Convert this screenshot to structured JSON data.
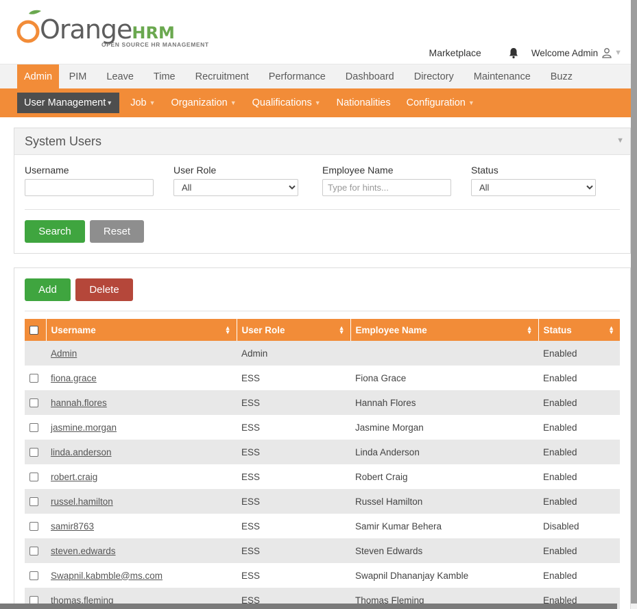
{
  "brand": {
    "logo_primary": "Orange",
    "logo_secondary": "HRM",
    "tagline": "OPEN SOURCE HR MANAGEMENT",
    "accent": "#f28c38",
    "green": "#3fa53f",
    "red": "#b5473a"
  },
  "topbar": {
    "marketplace": "Marketplace",
    "notifications_icon": "bell-icon",
    "welcome": "Welcome Admin",
    "user_icon": "user-icon"
  },
  "main_menu": [
    {
      "label": "Admin",
      "active": true
    },
    {
      "label": "PIM"
    },
    {
      "label": "Leave"
    },
    {
      "label": "Time"
    },
    {
      "label": "Recruitment"
    },
    {
      "label": "Performance"
    },
    {
      "label": "Dashboard"
    },
    {
      "label": "Directory"
    },
    {
      "label": "Maintenance"
    },
    {
      "label": "Buzz"
    }
  ],
  "sub_menu": [
    {
      "label": "User Management",
      "active": true,
      "dropdown": true
    },
    {
      "label": "Job",
      "dropdown": true
    },
    {
      "label": "Organization",
      "dropdown": true
    },
    {
      "label": "Qualifications",
      "dropdown": true
    },
    {
      "label": "Nationalities",
      "dropdown": false
    },
    {
      "label": "Configuration",
      "dropdown": true
    }
  ],
  "search_panel": {
    "title": "System Users",
    "username_label": "Username",
    "username_value": "",
    "user_role_label": "User Role",
    "user_role_value": "All",
    "employee_name_label": "Employee Name",
    "employee_name_placeholder": "Type for hints...",
    "status_label": "Status",
    "status_value": "All",
    "search_button": "Search",
    "reset_button": "Reset"
  },
  "list_panel": {
    "add_button": "Add",
    "delete_button": "Delete",
    "columns": [
      "Username",
      "User Role",
      "Employee Name",
      "Status"
    ],
    "rows": [
      {
        "username": "Admin",
        "role": "Admin",
        "employee": "",
        "status": "Enabled",
        "checkbox": false
      },
      {
        "username": "fiona.grace",
        "role": "ESS",
        "employee": "Fiona Grace",
        "status": "Enabled",
        "checkbox": true
      },
      {
        "username": "hannah.flores",
        "role": "ESS",
        "employee": "Hannah Flores",
        "status": "Enabled",
        "checkbox": true
      },
      {
        "username": "jasmine.morgan",
        "role": "ESS",
        "employee": "Jasmine Morgan",
        "status": "Enabled",
        "checkbox": true
      },
      {
        "username": "linda.anderson",
        "role": "ESS",
        "employee": "Linda Anderson",
        "status": "Enabled",
        "checkbox": true
      },
      {
        "username": "robert.craig",
        "role": "ESS",
        "employee": "Robert Craig",
        "status": "Enabled",
        "checkbox": true
      },
      {
        "username": "russel.hamilton",
        "role": "ESS",
        "employee": "Russel Hamilton",
        "status": "Enabled",
        "checkbox": true
      },
      {
        "username": "samir8763",
        "role": "ESS",
        "employee": "Samir Kumar Behera",
        "status": "Disabled",
        "checkbox": true
      },
      {
        "username": "steven.edwards",
        "role": "ESS",
        "employee": "Steven Edwards",
        "status": "Enabled",
        "checkbox": true
      },
      {
        "username": "Swapnil.kabmble@ms.com",
        "role": "ESS",
        "employee": "Swapnil Dhananjay Kamble",
        "status": "Enabled",
        "checkbox": true
      },
      {
        "username": "thomas.fleming",
        "role": "ESS",
        "employee": "Thomas Fleming",
        "status": "Enabled",
        "checkbox": true
      }
    ]
  }
}
